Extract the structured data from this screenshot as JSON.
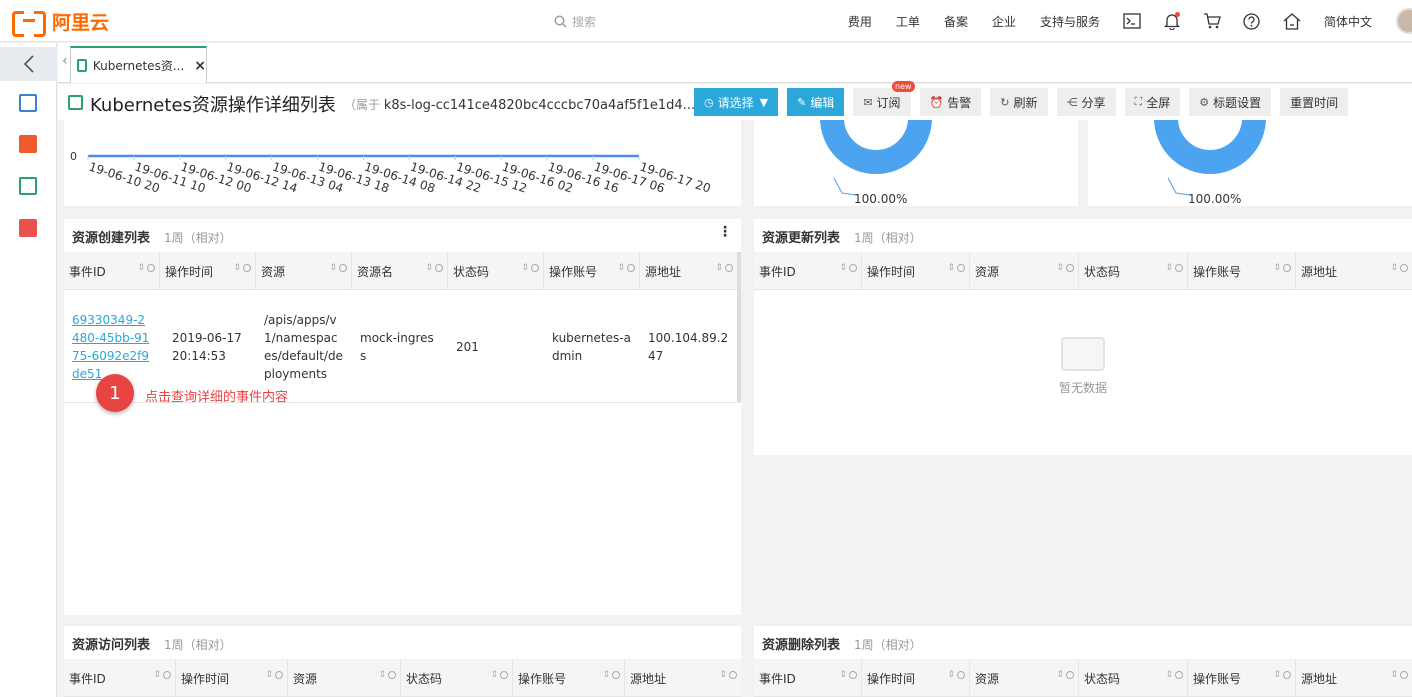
{
  "topbar": {
    "logo_text": "阿里云",
    "search_placeholder": "搜索",
    "nav": [
      "费用",
      "工单",
      "备案",
      "企业",
      "支持与服务"
    ],
    "language": "简体中文",
    "icons": [
      "terminal-icon",
      "bell-icon",
      "cart-icon",
      "help-icon",
      "home-icon"
    ]
  },
  "tabs": [
    {
      "label": "Kubernetes资...",
      "close": "×"
    }
  ],
  "dashboard": {
    "title": "Kubernetes资源操作详细列表",
    "belongs_prefix": "（属于",
    "project": "k8s-log-cc141ce4820bc4cccbc70a4af5f1e1d4...",
    "buttons": {
      "select": "请选择",
      "edit": "编辑",
      "subscribe": "订阅",
      "subscribe_badge": "new",
      "alert": "告警",
      "refresh": "刷新",
      "share": "分享",
      "fullscreen": "全屏",
      "title_settings": "标题设置",
      "reset_time": "重置时间"
    }
  },
  "chart_data": [
    {
      "type": "line",
      "x": [
        "19-06-10 20",
        "19-06-11 10",
        "19-06-12 00",
        "19-06-12 14",
        "19-06-13 04",
        "19-06-13 18",
        "19-06-14 08",
        "19-06-14 22",
        "19-06-15 12",
        "19-06-16 02",
        "19-06-16 16",
        "19-06-17 06",
        "19-06-17 20"
      ],
      "series": [
        {
          "values": [
            0,
            0,
            0,
            0,
            0,
            0,
            0,
            0,
            0,
            0,
            0,
            0,
            0
          ]
        }
      ],
      "y_tick": "0",
      "color": "#4a90e2"
    },
    {
      "type": "pie",
      "slices": [
        100
      ],
      "labels": [
        "100.00%"
      ],
      "color": "#4ca3f0"
    },
    {
      "type": "pie",
      "slices": [
        100
      ],
      "labels": [
        "100.00%"
      ],
      "color": "#4ca3f0"
    }
  ],
  "panels": {
    "create": {
      "title": "资源创建列表",
      "range": "1周（相对）",
      "more": "⋮",
      "columns": [
        "事件ID",
        "操作时间",
        "资源",
        "资源名",
        "状态码",
        "操作账号",
        "源地址"
      ],
      "rows": [
        [
          "69330349-2480-45bb-9175-6092e2f9de51",
          "2019-06-17 20:14:53",
          "/apis/apps/v1/namespaces/default/deployments",
          "mock-ingress",
          "201",
          "kubernetes-admin",
          "100.104.89.247"
        ]
      ]
    },
    "update": {
      "title": "资源更新列表",
      "range": "1周（相对）",
      "columns": [
        "事件ID",
        "操作时间",
        "资源",
        "状态码",
        "操作账号",
        "源地址"
      ],
      "empty": "暂无数据"
    },
    "access": {
      "title": "资源访问列表",
      "range": "1周（相对）",
      "columns": [
        "事件ID",
        "操作时间",
        "资源",
        "状态码",
        "操作账号",
        "源地址"
      ]
    },
    "delete": {
      "title": "资源删除列表",
      "range": "1周（相对）",
      "columns": [
        "事件ID",
        "操作时间",
        "资源",
        "状态码",
        "操作账号",
        "源地址"
      ]
    }
  },
  "annotation": {
    "number": "1",
    "text": "点击查询详细的事件内容"
  }
}
